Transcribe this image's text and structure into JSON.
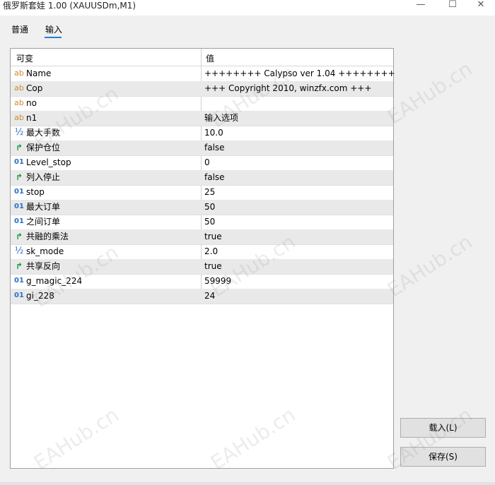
{
  "window": {
    "title": "俄罗斯套娃 1.00 (XAUUSDm,M1)",
    "minimize_icon": "minimize-icon",
    "maximize_icon": "maximize-icon",
    "close_icon": "close-icon"
  },
  "tabs": [
    {
      "label": "普通"
    },
    {
      "label": "输入"
    }
  ],
  "table": {
    "col_variable": "可变",
    "col_value": "值",
    "rows": [
      {
        "type": "ab",
        "name": "Name",
        "value": "++++++++ Calypso ver 1.04 ++++++++"
      },
      {
        "type": "ab",
        "name": "Cop",
        "value": "+++ Copyright 2010, winzfx.com +++"
      },
      {
        "type": "ab",
        "name": "no",
        "value": ""
      },
      {
        "type": "ab",
        "name": "n1",
        "value": "输入选项"
      },
      {
        "type": "½",
        "name": "最大手数",
        "value": "10.0"
      },
      {
        "type": "bool",
        "name": "保护仓位",
        "value": "false"
      },
      {
        "type": "01",
        "name": "Level_stop",
        "value": "0"
      },
      {
        "type": "bool",
        "name": "列入停止",
        "value": "false"
      },
      {
        "type": "01",
        "name": "stop",
        "value": "25"
      },
      {
        "type": "01",
        "name": "最大订单",
        "value": "50"
      },
      {
        "type": "01",
        "name": "之间订单",
        "value": "50"
      },
      {
        "type": "bool",
        "name": "共融的乘法",
        "value": "true"
      },
      {
        "type": "½",
        "name": "sk_mode",
        "value": "2.0"
      },
      {
        "type": "bool",
        "name": "共享反向",
        "value": "true"
      },
      {
        "type": "01",
        "name": "g_magic_224",
        "value": "59999"
      },
      {
        "type": "01",
        "name": "gi_228",
        "value": "24"
      }
    ]
  },
  "buttons": {
    "load": "载入(L)",
    "save": "保存(S)"
  },
  "watermark": "EAHub.cn"
}
